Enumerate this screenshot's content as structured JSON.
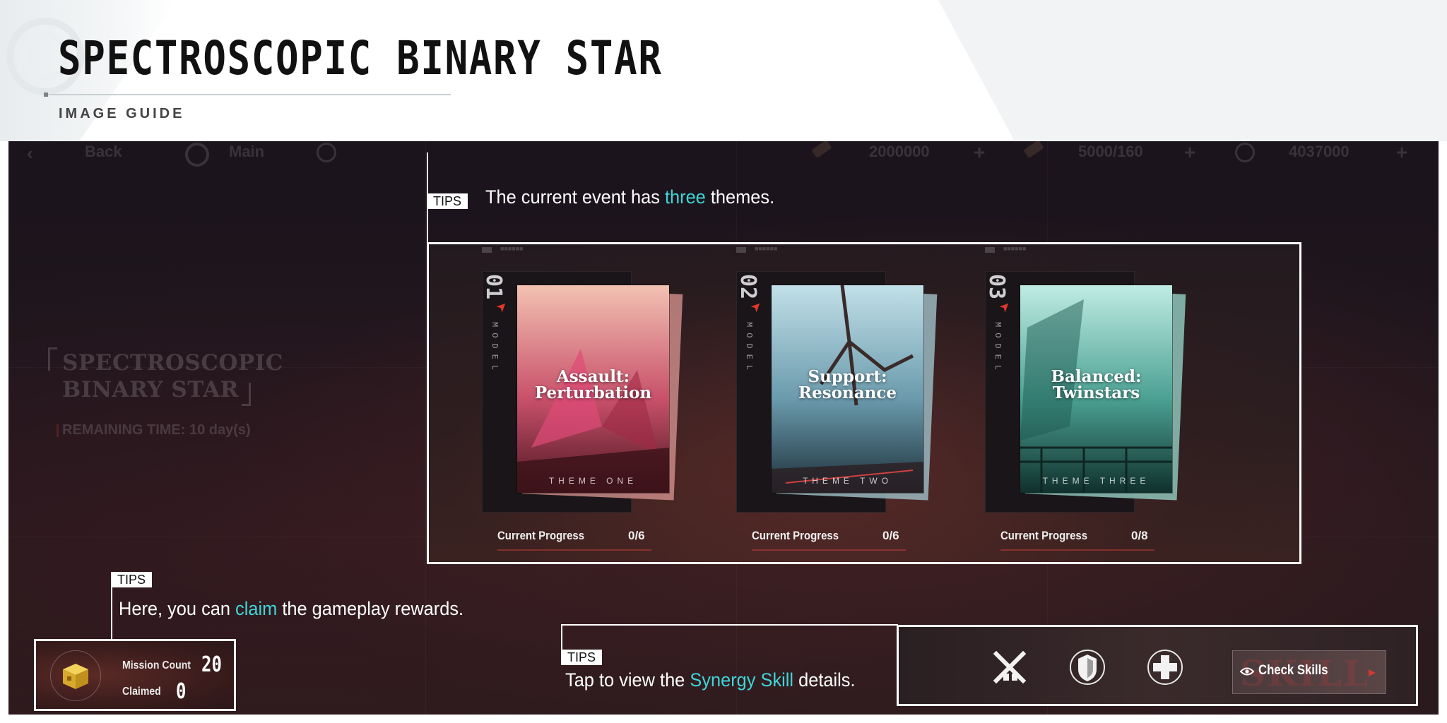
{
  "header": {
    "title": "SPECTROSCOPIC BINARY STAR",
    "subtitle": "IMAGE GUIDE"
  },
  "topbar": {
    "back_label": "Back",
    "main_label": "Main",
    "currency_1": "2000000",
    "currency_2": "5000/160",
    "currency_3": "4037000",
    "plus": "+"
  },
  "event": {
    "name_line1": "SPECTROSCOPIC",
    "name_line2": "BINARY STAR",
    "remaining_label": "REMAINING TIME:",
    "remaining_value": "10 day(s)"
  },
  "tips": {
    "tag": "TIPS",
    "themes": {
      "before": "The current event has ",
      "highlight": "three",
      "after": " themes."
    },
    "rewards": {
      "before": "Here, you can ",
      "highlight": "claim",
      "after": " the gameplay rewards."
    },
    "skills": {
      "before": "Tap to view the ",
      "highlight": "Synergy Skill",
      "after": " details."
    }
  },
  "themes": [
    {
      "number": "01",
      "model": "MODEL",
      "title_line1": "Assault:",
      "title_line2": "Perturbation",
      "theme_label": "THEME ONE",
      "progress_label": "Current Progress",
      "progress_value": "0/6",
      "colors": [
        "#f0b2a4",
        "#c0405a",
        "#5a1a26"
      ]
    },
    {
      "number": "02",
      "model": "MODEL",
      "title_line1": "Support:",
      "title_line2": "Resonance",
      "theme_label": "THEME TWO",
      "progress_label": "Current Progress",
      "progress_value": "0/6",
      "colors": [
        "#b8dce4",
        "#5a8fa2",
        "#1e3440"
      ]
    },
    {
      "number": "03",
      "model": "MODEL",
      "title_line1": "Balanced:",
      "title_line2": "Twinstars",
      "theme_label": "THEME THREE",
      "progress_label": "Current Progress",
      "progress_value": "0/8",
      "colors": [
        "#b4e4dc",
        "#3e9a8e",
        "#123a36"
      ]
    }
  ],
  "mission": {
    "count_label": "Mission Count",
    "count_value": "20",
    "claimed_label": "Claimed",
    "claimed_value": "0"
  },
  "skills": {
    "icons": [
      "crossed-guns-icon",
      "shield-icon",
      "medical-cross-icon"
    ],
    "check_label": "Check Skills",
    "ghost_text": "SKILL"
  },
  "colors": {
    "highlight": "#3fd6d8",
    "accent_red": "#d23a30"
  }
}
